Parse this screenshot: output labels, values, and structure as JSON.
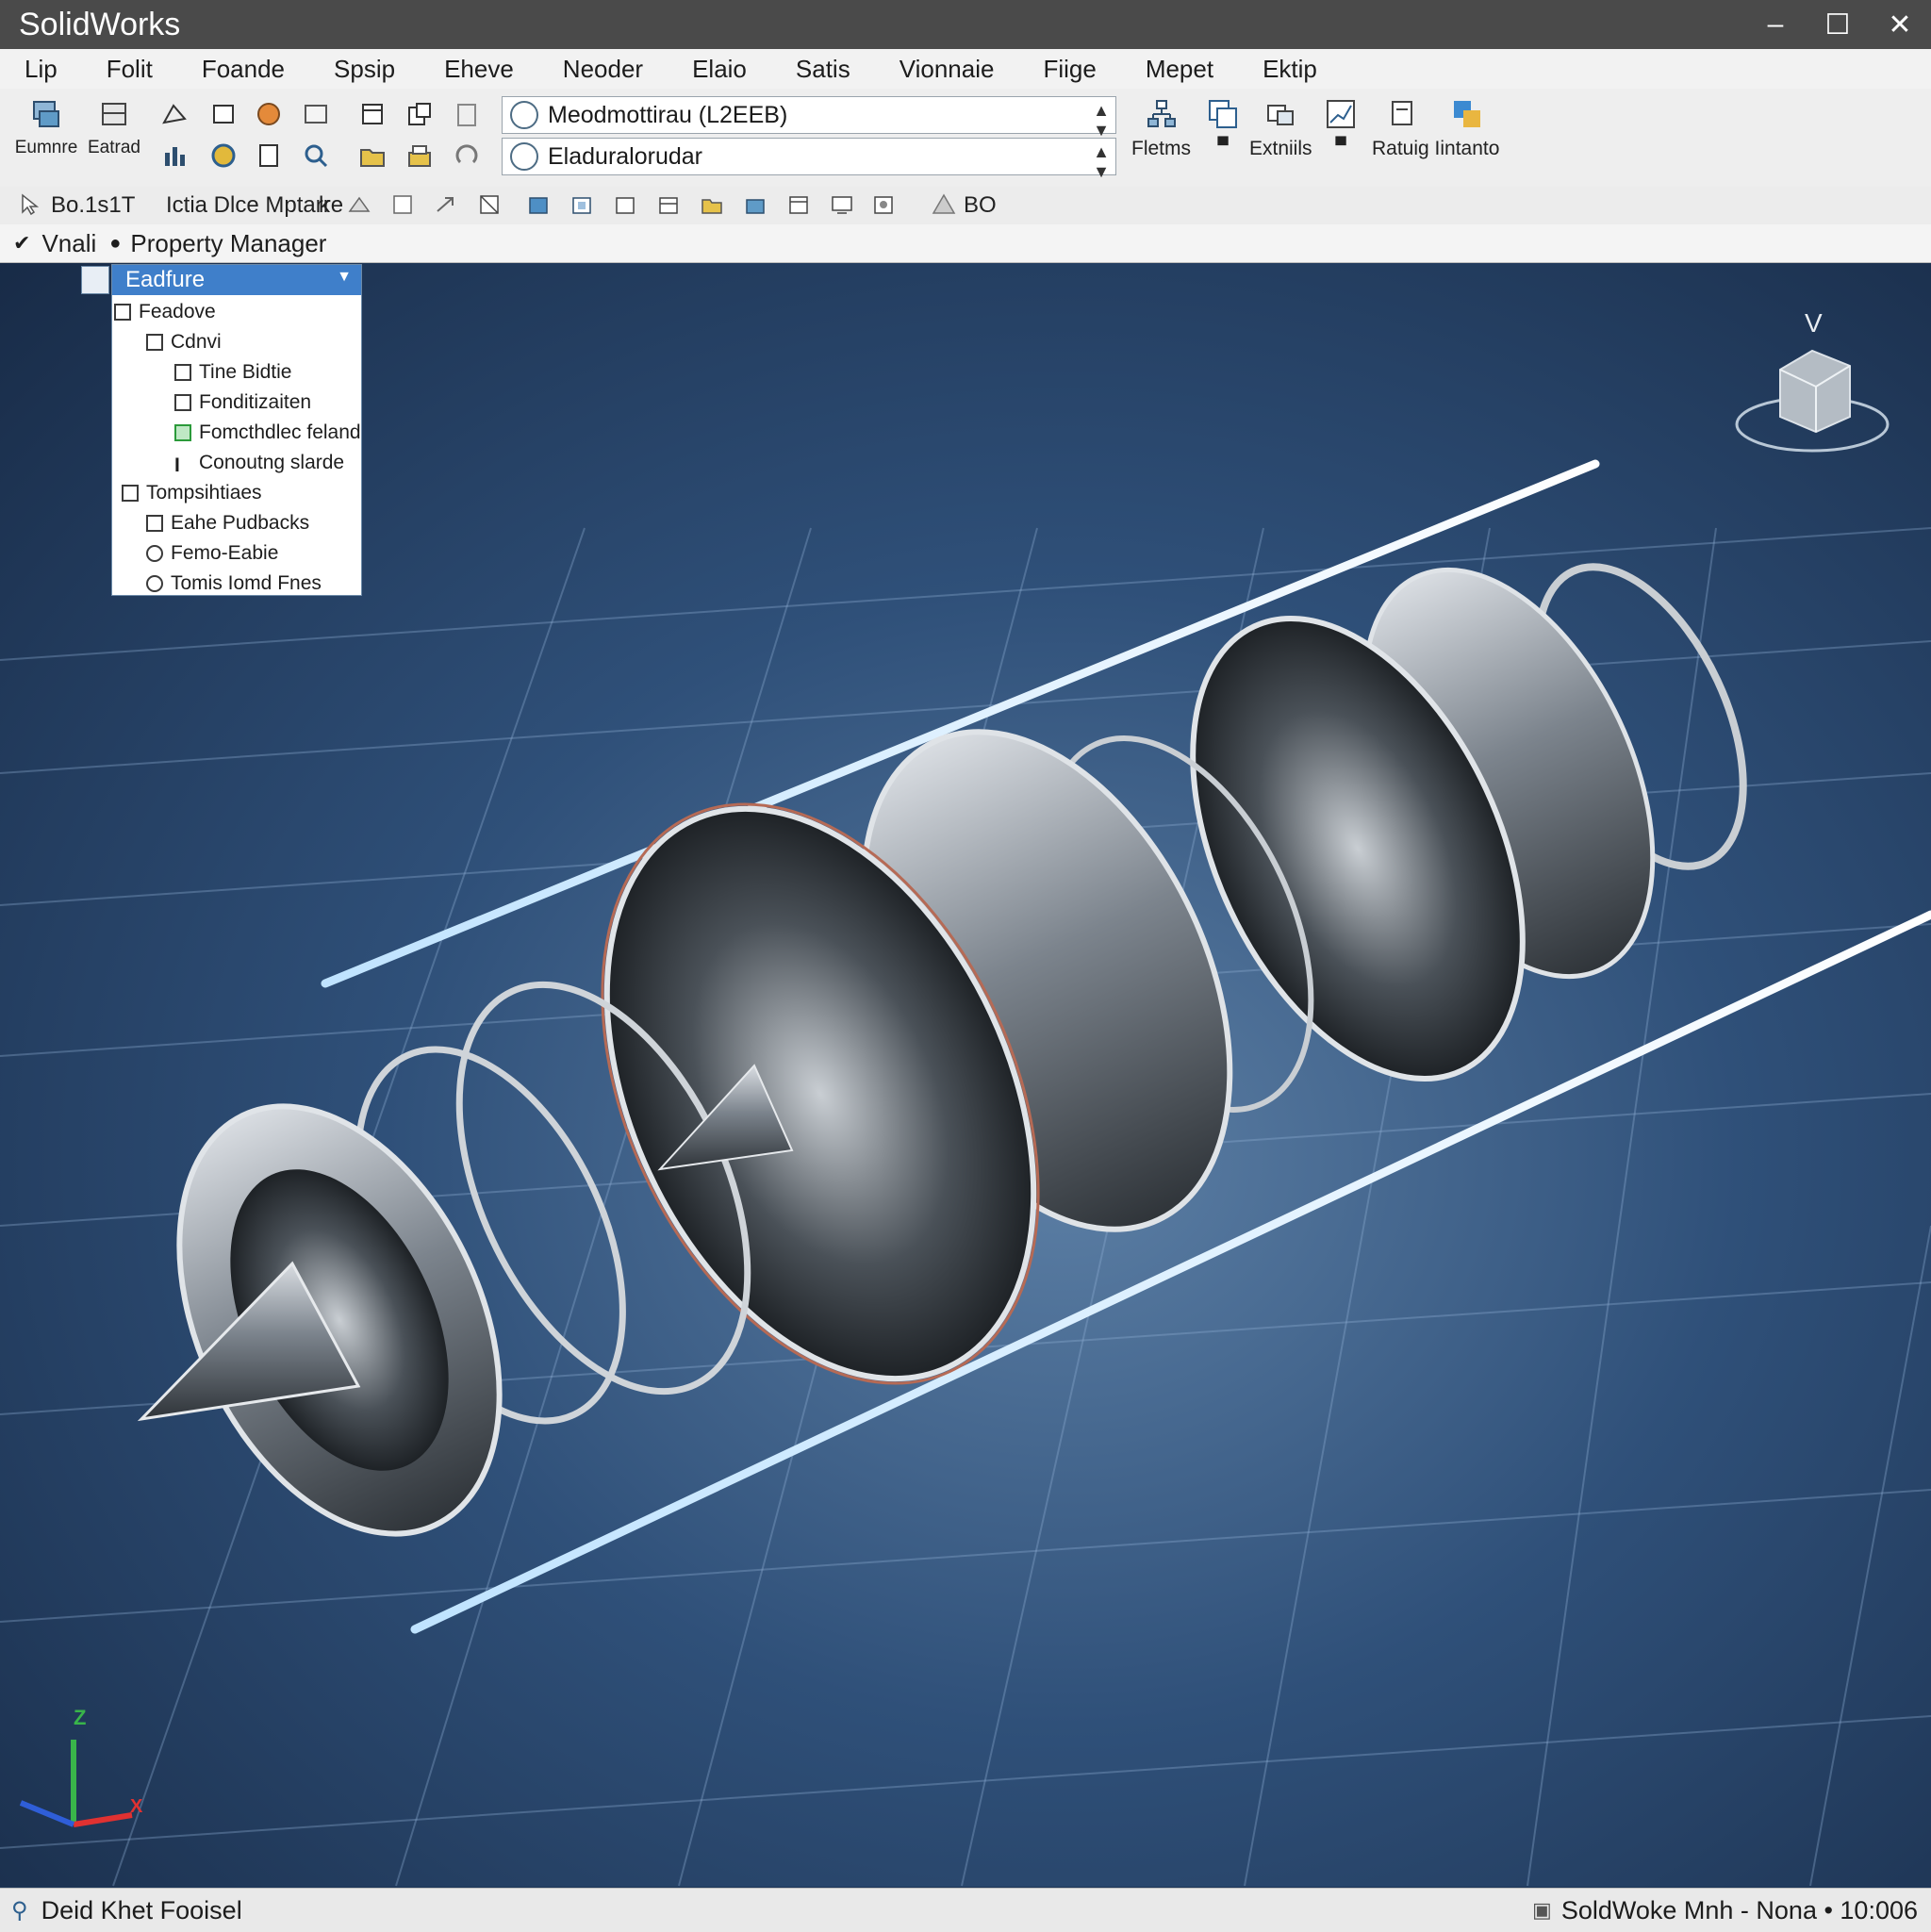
{
  "app": {
    "title": "SolidWorks"
  },
  "window_controls": {
    "minimize": "–",
    "maximize": "☐",
    "close": "✕"
  },
  "menu": [
    "Lip",
    "Folit",
    "Foande",
    "Spsip",
    "Eheve",
    "Neoder",
    "Elaio",
    "Satis",
    "Vionnaie",
    "Fiige",
    "Mepet",
    "Ektip"
  ],
  "toolbar": {
    "btn_left1": "Eumnre",
    "btn_left2": "Eatrad",
    "combo1": "Meodmottirau (L2EEB)",
    "combo2": "Eladuralorudar",
    "right_btn1": "Fletms",
    "right_btn2": "Extniils",
    "right_btn3": "Ratuig Iintanto"
  },
  "toolbar2": {
    "scale": "Bo.1s1T",
    "text": "Ictia Dlce Mptarre",
    "tail": "k",
    "count": "BO"
  },
  "property_manager": {
    "prefix": "Vnali",
    "label": "Property Manager"
  },
  "feature_tree": {
    "selected": "Eadfure",
    "items": [
      {
        "label": "Feadove"
      },
      {
        "label": "Cdnvi"
      },
      {
        "label": "Tine Bidtie"
      },
      {
        "label": "Fonditizaiten"
      },
      {
        "label": "Fomcthdlec feland"
      },
      {
        "label": "Conoutng slarde"
      },
      {
        "label": "Tompsihtiaes"
      },
      {
        "label": "Eahe Pudbacks"
      },
      {
        "label": "Femo-Eabie"
      },
      {
        "label": "Tomis Iomd Fnes"
      }
    ]
  },
  "viewport": {
    "view_cube_label": "V",
    "axis_z": "Z",
    "axis_x": "X"
  },
  "status": {
    "left": "Deid Khet Fooisel",
    "right": "SoldWoke Mnh - Nona • 10:006"
  },
  "colors": {
    "title_bg": "#4a4a4a",
    "selection": "#3f7fca",
    "viewport_bg": "#2f5079"
  }
}
